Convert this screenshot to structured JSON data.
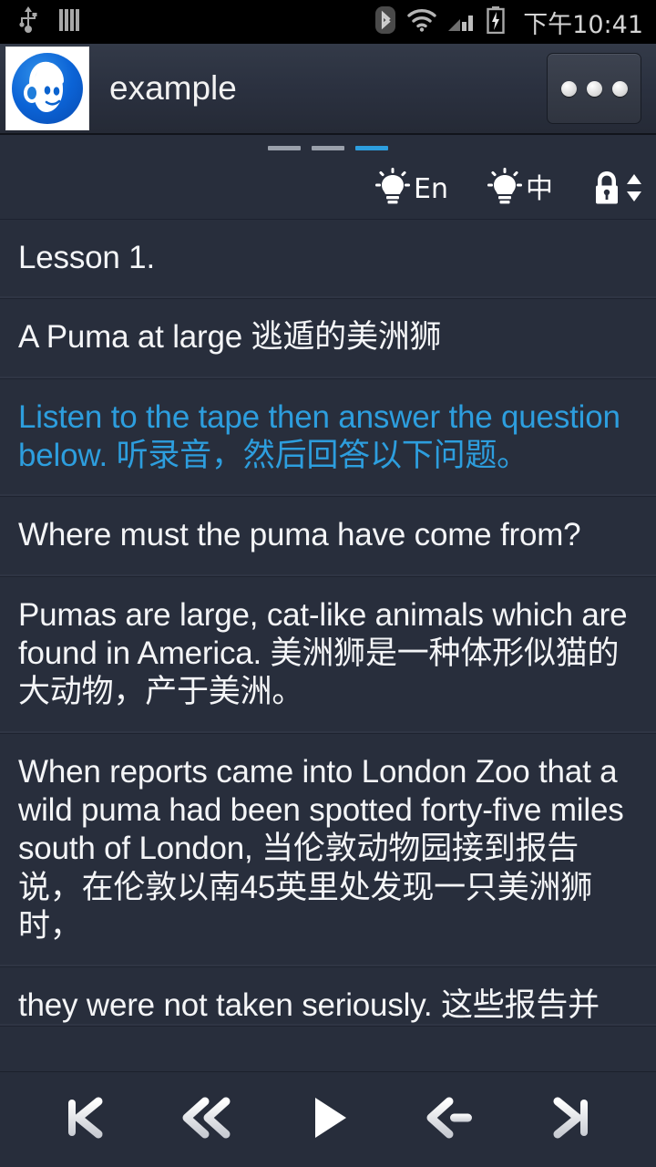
{
  "statusbar": {
    "time": "下午10:41",
    "icons": [
      "usb-icon",
      "vibrate-bars-icon",
      "bluetooth-icon",
      "wifi-icon",
      "cellular-signal-icon",
      "battery-charging-icon"
    ]
  },
  "actionbar": {
    "app_icon": "headphone-face-icon",
    "title": "example",
    "overflow_label": "overflow-menu"
  },
  "subbar": {
    "pager": [
      {
        "name": "page-dash-1",
        "active": false
      },
      {
        "name": "page-dash-2",
        "active": false
      },
      {
        "name": "page-dash-3",
        "active": true
      }
    ],
    "tools": [
      {
        "icon": "lightbulb-icon",
        "label": "En",
        "name": "hint-english-toggle"
      },
      {
        "icon": "lightbulb-icon",
        "label": "中",
        "name": "hint-chinese-toggle"
      },
      {
        "icon": "lock-icon",
        "label": "",
        "name": "lock-scroll-toggle"
      }
    ]
  },
  "list": {
    "rows": [
      {
        "text": "Lesson 1.",
        "highlight": false
      },
      {
        "text": "A Puma at large  逃遁的美洲狮",
        "highlight": false
      },
      {
        "text": "Listen to the tape then answer the question below.  听录音，然后回答以下问题。",
        "highlight": true
      },
      {
        "text": "Where must the puma have come from?",
        "highlight": false
      },
      {
        "text": "Pumas are large, cat-like animals which are found in America.   美洲狮是一种体形似猫的大动物，产于美洲。",
        "highlight": false
      },
      {
        "text": "When reports came into London Zoo that a wild puma had been spotted forty-five miles south of London,   当伦敦动物园接到报告说，在伦敦以南45英里处发现一只美洲狮时，",
        "highlight": false
      },
      {
        "text": "they were not taken seriously.  这些报告并",
        "highlight": false
      }
    ]
  },
  "player": {
    "buttons": [
      {
        "name": "skip-to-start-button",
        "icon": "skip-previous-icon"
      },
      {
        "name": "rewind-button",
        "icon": "fast-rewind-icon"
      },
      {
        "name": "play-button",
        "icon": "play-icon"
      },
      {
        "name": "previous-sentence-button",
        "icon": "arrow-left-bar-icon"
      },
      {
        "name": "skip-to-end-button",
        "icon": "skip-next-icon"
      }
    ]
  },
  "colors": {
    "background": "#282e3c",
    "accent": "#2d9ede",
    "text": "#f4f5f7",
    "statusbar_bg": "#000000"
  }
}
